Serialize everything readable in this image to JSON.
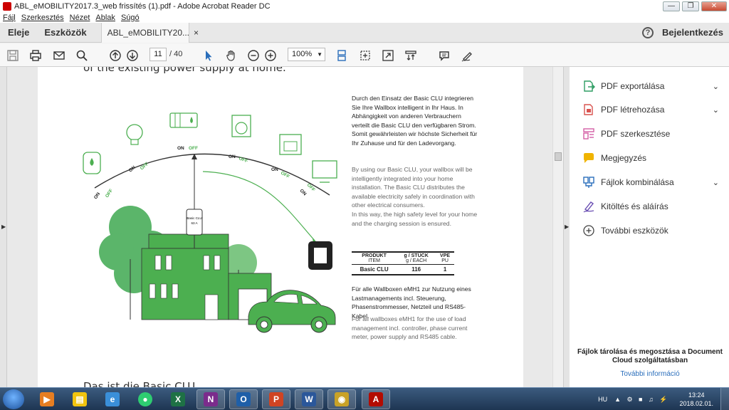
{
  "window": {
    "title": "ABL_eMOBILITY2017.3_web frissítés (1).pdf - Adobe Acrobat Reader DC",
    "minimize": "—",
    "maximize": "❐",
    "close": "✕"
  },
  "menu": [
    "Fájl",
    "Szerkesztés",
    "Nézet",
    "Ablak",
    "Súgó"
  ],
  "tabs": {
    "home": "Eleje",
    "tools": "Eszközök",
    "document": "ABL_eMOBILITY20...",
    "close": "×",
    "help": "?",
    "signin": "Bejelentkezés"
  },
  "toolbar": {
    "current_page": "11",
    "total_pages": "/ 40",
    "zoom": "100%"
  },
  "document": {
    "top_cut": "of the existing power supply at home.",
    "bottom_cut": "Das ist die Basic CLU",
    "de_paragraph": "Durch den Einsatz der Basic CLU integrieren Sie Ihre Wallbox intelligent in Ihr Haus. In Abhängigkeit von anderen Verbrauchern verteilt die Basic CLU den verfügbaren Strom. Somit gewährleisten wir höchste Sicherheit für Ihr Zuhause und für den Ladevorgang.",
    "en_paragraph1": "By using our Basic CLU, your wallbox will be intelligently integrated into your home installation. The Basic CLU distributes the available electricity safely in coordination with other electrical consumers.",
    "en_paragraph2": "In this way, the high safety level for your home and the charging session is ensured.",
    "table": {
      "headers": [
        {
          "main": "PRODUKT",
          "sub": "ITEM"
        },
        {
          "main": "g / STÜCK",
          "sub": "g / EACH"
        },
        {
          "main": "VPE",
          "sub": "PU"
        }
      ],
      "rows": [
        [
          "Basic CLU",
          "116",
          "1"
        ]
      ]
    },
    "de_paragraph2": "Für alle Wallboxen eMH1 zur Nutzung eines Lastmanagements incl. Steuerung, Phasenstrommesser, Netzteil und RS485-Kabel.",
    "en_paragraph3": "For all wallboxes eMH1 for the use of load management incl. controller, phase current meter, power supply and RS485 cable.",
    "diagram": {
      "on": "ON",
      "off": "OFF",
      "device_label_1": "Basic CLU",
      "device_label_2": "63 A",
      "green": "#4caf50"
    }
  },
  "tools_pane": {
    "items": [
      {
        "label": "PDF exportálása",
        "has_chevron": true,
        "color": "#2e9d63",
        "icon": "export-pdf-icon"
      },
      {
        "label": "PDF létrehozása",
        "has_chevron": true,
        "color": "#d9534f",
        "icon": "create-pdf-icon"
      },
      {
        "label": "PDF szerkesztése",
        "has_chevron": false,
        "color": "#d45fa6",
        "icon": "edit-pdf-icon"
      },
      {
        "label": "Megjegyzés",
        "has_chevron": false,
        "color": "#f0b400",
        "icon": "comment-icon"
      },
      {
        "label": "Fájlok kombinálása",
        "has_chevron": true,
        "color": "#2a6ebb",
        "icon": "combine-files-icon"
      },
      {
        "label": "Kitöltés és aláírás",
        "has_chevron": false,
        "color": "#6a4fb3",
        "icon": "fill-sign-icon"
      },
      {
        "label": "További eszközök",
        "has_chevron": false,
        "color": "#444444",
        "icon": "more-tools-icon"
      }
    ],
    "cloud_text": "Fájlok tárolása és megosztása a Document Cloud szolgáltatásban",
    "cloud_link": "További információ"
  },
  "taskbar": {
    "language": "HU",
    "time": "13:24",
    "date": "2018.02.01.",
    "apps": [
      {
        "name": "media-player",
        "glyph": "▶",
        "color": "#e67e22"
      },
      {
        "name": "explorer",
        "glyph": "▤",
        "color": "#f1c40f"
      },
      {
        "name": "internet-explorer",
        "glyph": "e",
        "color": "#3a8fd9"
      },
      {
        "name": "chrome",
        "glyph": "●",
        "color": "#2ecc71"
      },
      {
        "name": "excel",
        "glyph": "X",
        "color": "#1e7145"
      },
      {
        "name": "onenote",
        "glyph": "N",
        "color": "#7b2c8c"
      },
      {
        "name": "outlook",
        "glyph": "O",
        "color": "#1f5fa8"
      },
      {
        "name": "powerpoint",
        "glyph": "P",
        "color": "#d04423"
      },
      {
        "name": "word",
        "glyph": "W",
        "color": "#2b579a"
      },
      {
        "name": "app-yellow",
        "glyph": "◉",
        "color": "#c9a227"
      },
      {
        "name": "acrobat",
        "glyph": "A",
        "color": "#b30b00"
      }
    ]
  }
}
